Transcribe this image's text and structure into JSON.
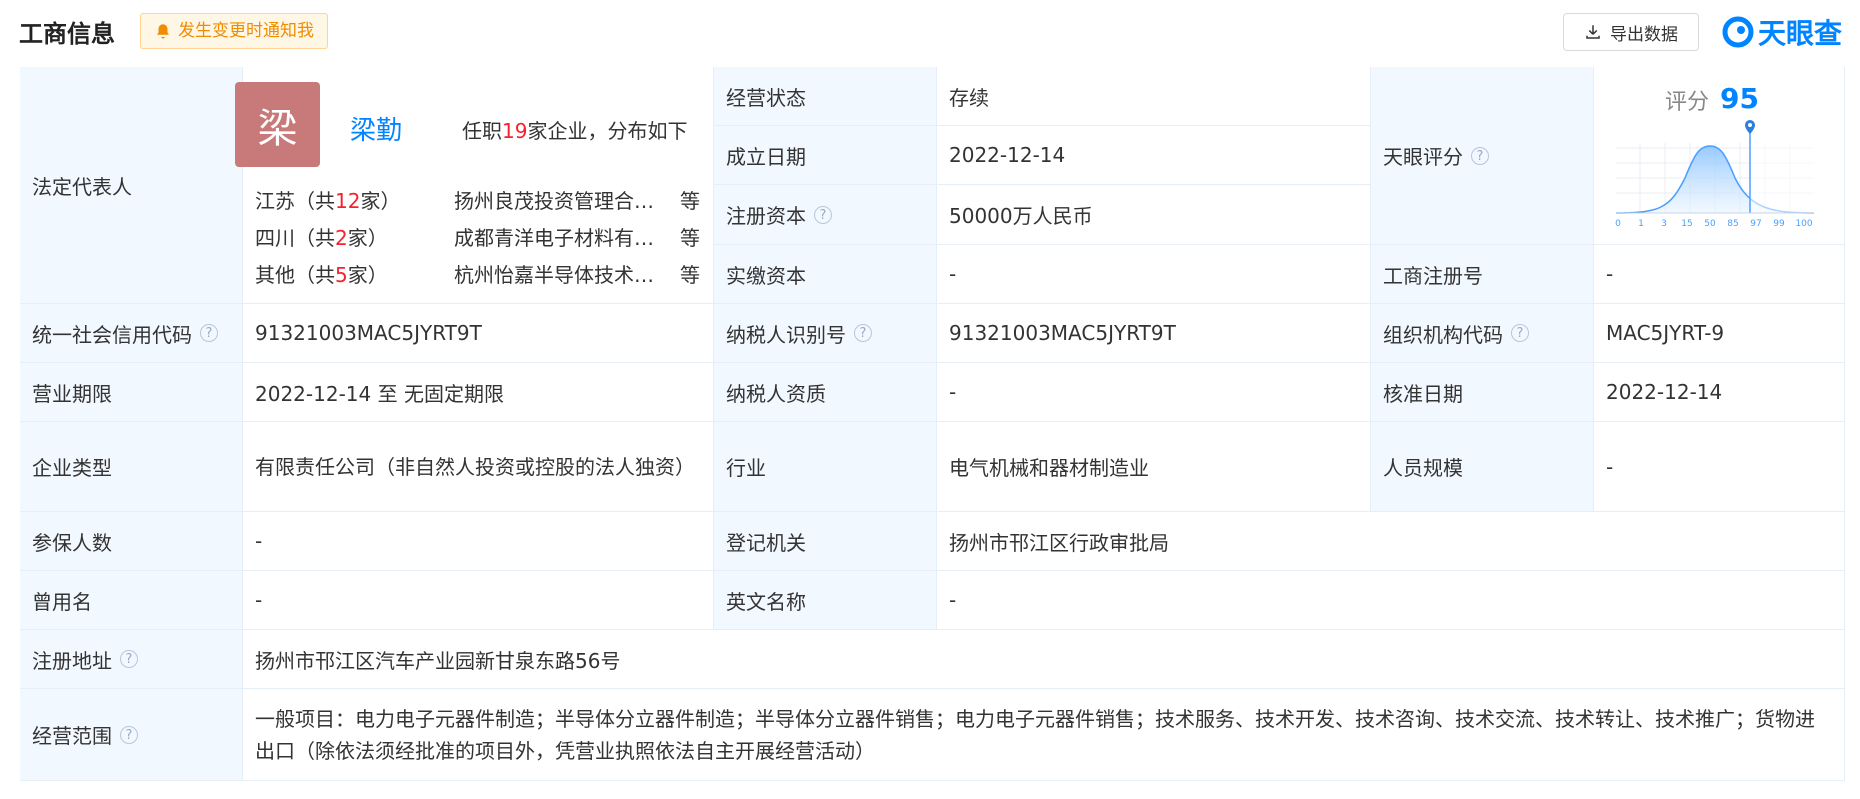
{
  "header": {
    "title": "工商信息",
    "notify_label": "发生变更时通知我",
    "export_label": "导出数据",
    "logo_text": "天眼查",
    "colors": {
      "accent": "#0084ff",
      "label_bg": "#f2f8ff",
      "border": "#e6eef8",
      "notify_bg": "#fff7e6",
      "notify_text": "#f08c00",
      "highlight": "#f5222d"
    }
  },
  "legal_rep": {
    "label": "法定代表人",
    "avatar_char": "梁",
    "name": "梁勤",
    "info_pre": "任职",
    "info_count": "19",
    "info_post": "家企业，分布如下",
    "regions": [
      {
        "name_pre": "江苏（共",
        "count": "12",
        "name_post": "家）",
        "company": "扬州良茂投资管理合伙企业",
        "suffix": "等"
      },
      {
        "name_pre": "四川（共",
        "count": "2",
        "name_post": "家）",
        "company": "成都青洋电子材料有限公司",
        "suffix": "等"
      },
      {
        "name_pre": "其他（共",
        "count": "5",
        "name_post": "家）",
        "company": "杭州怡嘉半导体技术有限公司",
        "suffix": "等"
      }
    ]
  },
  "fields": {
    "status_label": "经营状态",
    "status_value": "存续",
    "founded_label": "成立日期",
    "founded_value": "2022-12-14",
    "capital_label": "注册资本",
    "capital_value": "50000万人民币",
    "paid_label": "实缴资本",
    "paid_value": "-",
    "score_label": "天眼评分",
    "regno_label": "工商注册号",
    "regno_value": "-",
    "credit_label": "统一社会信用代码",
    "credit_value": "91321003MAC5JYRT9T",
    "taxid_label": "纳税人识别号",
    "taxid_value": "91321003MAC5JYRT9T",
    "org_label": "组织机构代码",
    "org_value": "MAC5JYRT-9",
    "term_label": "营业期限",
    "term_value": "2022-12-14 至 无固定期限",
    "taxqual_label": "纳税人资质",
    "taxqual_value": "-",
    "approve_label": "核准日期",
    "approve_value": "2022-12-14",
    "type_label": "企业类型",
    "type_value": "有限责任公司（非自然人投资或控股的法人独资）",
    "industry_label": "行业",
    "industry_value": "电气机械和器材制造业",
    "staff_label": "人员规模",
    "staff_value": "-",
    "insured_label": "参保人数",
    "insured_value": "-",
    "authority_label": "登记机关",
    "authority_value": "扬州市邗江区行政审批局",
    "formername_label": "曾用名",
    "formername_value": "-",
    "english_label": "英文名称",
    "english_value": "-",
    "address_label": "注册地址",
    "address_value": "扬州市邗江区汽车产业园新甘泉东路56号",
    "scope_label": "经营范围",
    "scope_value": "一般项目：电力电子元器件制造；半导体分立器件制造；半导体分立器件销售；电力电子元器件销售；技术服务、技术开发、技术咨询、技术交流、技术转让、技术推广；货物进出口（除依法须经批准的项目外，凭营业执照依法自主开展经营活动）"
  },
  "score": {
    "label": "评分",
    "value": "95",
    "ticks": [
      "0",
      "1",
      "3",
      "15",
      "50",
      "85",
      "97",
      "99",
      "100"
    ]
  }
}
